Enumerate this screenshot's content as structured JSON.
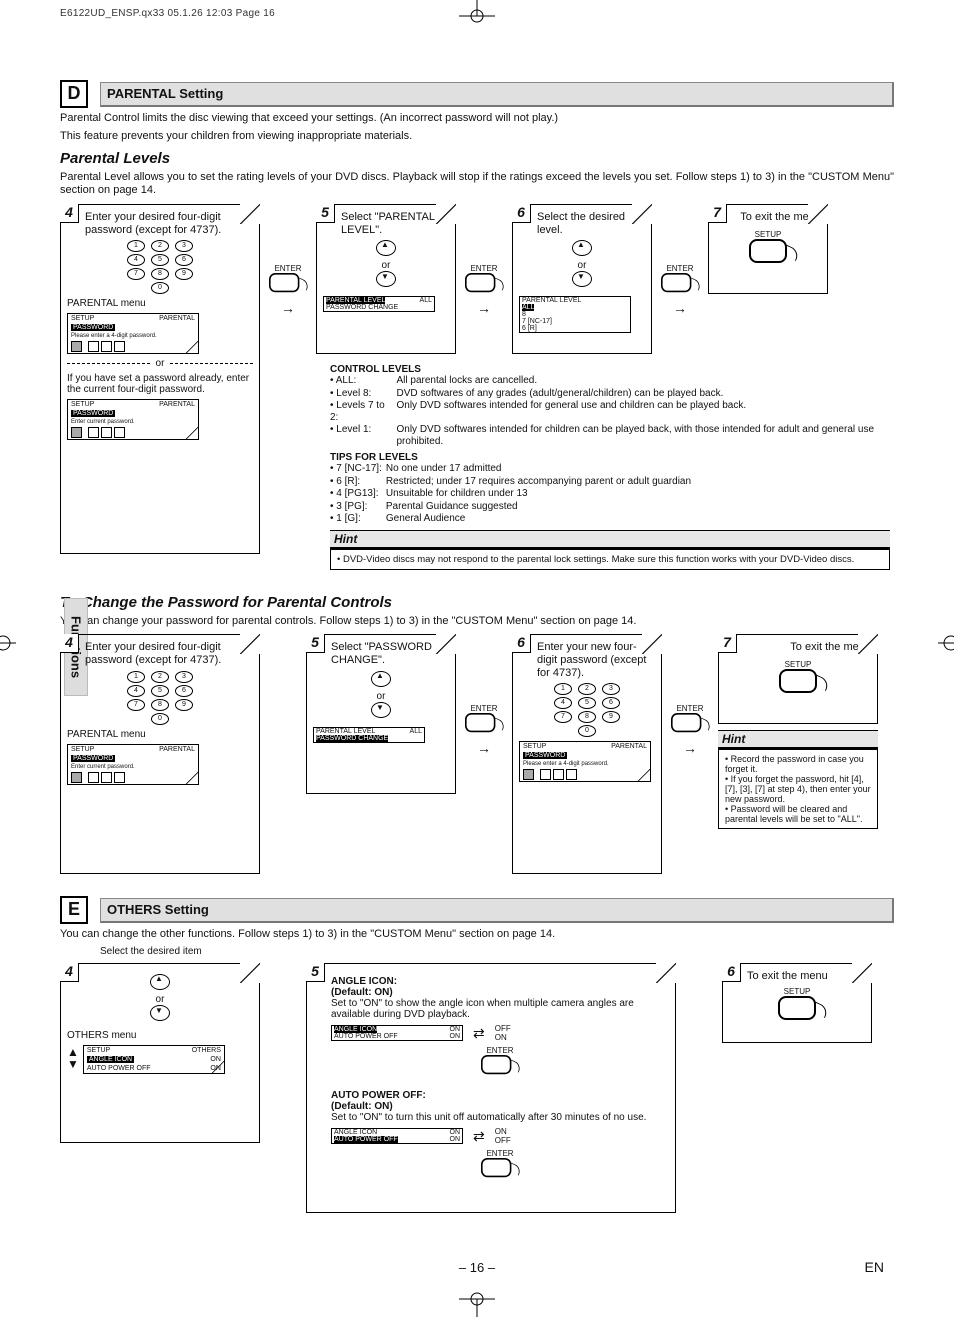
{
  "print_header": "E6122UD_ENSP.qx33  05.1.26 12:03  Page 16",
  "side_tab": "Functions",
  "footer_page": "– 16 –",
  "footer_lang": "EN",
  "secD": {
    "letter": "D",
    "title": "PARENTAL Setting",
    "intro1": "Parental Control limits the disc viewing that exceed your settings. (An incorrect password will not play.)",
    "intro2": "This feature prevents your children from viewing inappropriate materials.",
    "levels_h": "Parental Levels",
    "levels_p": "Parental Level allows you to set the rating levels of your DVD discs. Playback will stop if the ratings exceed the levels you set. Follow steps 1) to 3) in the \"CUSTOM Menu\" section on page 14.",
    "step4": "Enter your desired four-digit password (except for 4737).",
    "step4_label": "PARENTAL menu",
    "menuA_head_l": "SETUP",
    "menuA_head_r": "PARENTAL",
    "menuA_row": "PASSWORD",
    "menuA_hint": "Please enter a 4-digit password.",
    "or": "or",
    "already": "If you have set a password already, enter the current four-digit password.",
    "menuB_row": "PASSWORD",
    "menuB_hint": "Enter current password.",
    "enter": "ENTER",
    "step5": "Select \"PARENTAL LEVEL\".",
    "opt5_a": "PARENTAL LEVEL",
    "opt5_a_v": "ALL",
    "opt5_b": "PASSWORD CHANGE",
    "step6": "Select the desired level.",
    "opt6_a": "PARENTAL LEVEL",
    "opt6_l": [
      "ALL",
      "8",
      "7 [NC-17]",
      "6 [R]"
    ],
    "step7": "To exit the menu",
    "setup": "SETUP",
    "ctrl_h": "CONTROL LEVELS",
    "ctrl": [
      [
        "• ALL:",
        "All parental locks are cancelled."
      ],
      [
        "• Level 8:",
        "DVD softwares of any grades (adult/general/children) can be played back."
      ],
      [
        "• Levels 7 to 2:",
        "Only DVD softwares intended for general use and children can be played back."
      ],
      [
        "• Level 1:",
        "Only DVD softwares intended for children can be played back, with those intended for adult and general use prohibited."
      ]
    ],
    "tips_h": "TIPS FOR LEVELS",
    "tips": [
      [
        "• 7 [NC-17]:",
        "No one under 17 admitted"
      ],
      [
        "• 6 [R]:",
        "Restricted; under 17 requires accompanying parent or adult guardian"
      ],
      [
        "• 4 [PG13]:",
        "Unsuitable for children under 13"
      ],
      [
        "• 3 [PG]:",
        "Parental Guidance suggested"
      ],
      [
        "• 1 [G]:",
        "General Audience"
      ]
    ],
    "hint_h": "Hint",
    "hint_t": "• DVD-Video discs may not respond to the parental lock settings. Make sure this function works with your DVD-Video discs."
  },
  "pwd": {
    "h": "To Change the Password for Parental Controls",
    "p": "You can change your password for parental controls.  Follow steps 1) to 3) in the \"CUSTOM Menu\" section on page 14.",
    "step4": "Enter your desired four-digit password (except for 4737).",
    "step4_label": "PARENTAL menu",
    "menu_row": "PASSWORD",
    "menu_hint": "Enter current password.",
    "step5": "Select \"PASSWORD CHANGE\".",
    "opt5_a": "PARENTAL LEVEL",
    "opt5_a_v": "ALL",
    "opt5_b": "PASSWORD CHANGE",
    "step6": "Enter your new four-digit password (except for 4737).",
    "menu6_hint": "Please enter a 4-digit password.",
    "step7": "To exit the menu",
    "hint_h": "Hint",
    "hint": [
      "• Record the password in case you forget it.",
      "• If you forget the password, hit [4], [7], [3], [7] at step 4), then enter your new password.",
      "• Password will be cleared and parental levels will be set to \"ALL\"."
    ]
  },
  "secE": {
    "letter": "E",
    "title": "OTHERS Setting",
    "p": "You can change the other functions. Follow steps 1) to 3) in the \"CUSTOM Menu\" section on page 14.",
    "sel": "Select the desired item",
    "others_label": "OTHERS menu",
    "menu_head_l": "SETUP",
    "menu_head_r": "OTHERS",
    "menu_r1_a": "ANGLE ICON",
    "menu_r1_b": "ON",
    "menu_r2_a": "AUTO POWER OFF",
    "menu_r2_b": "ON",
    "angle_h": "ANGLE ICON:",
    "angle_d": "(Default: ON)",
    "angle_t": "Set to \"ON\" to show the angle icon when multiple camera angles are available during DVD playback.",
    "angle_opt_on": "ON",
    "angle_opt_off": "OFF",
    "apo_h": "AUTO POWER OFF:",
    "apo_d": "(Default: ON)",
    "apo_t": "Set to \"ON\" to turn this unit off automatically after 30 minutes of no use.",
    "step6": "To exit the menu"
  }
}
